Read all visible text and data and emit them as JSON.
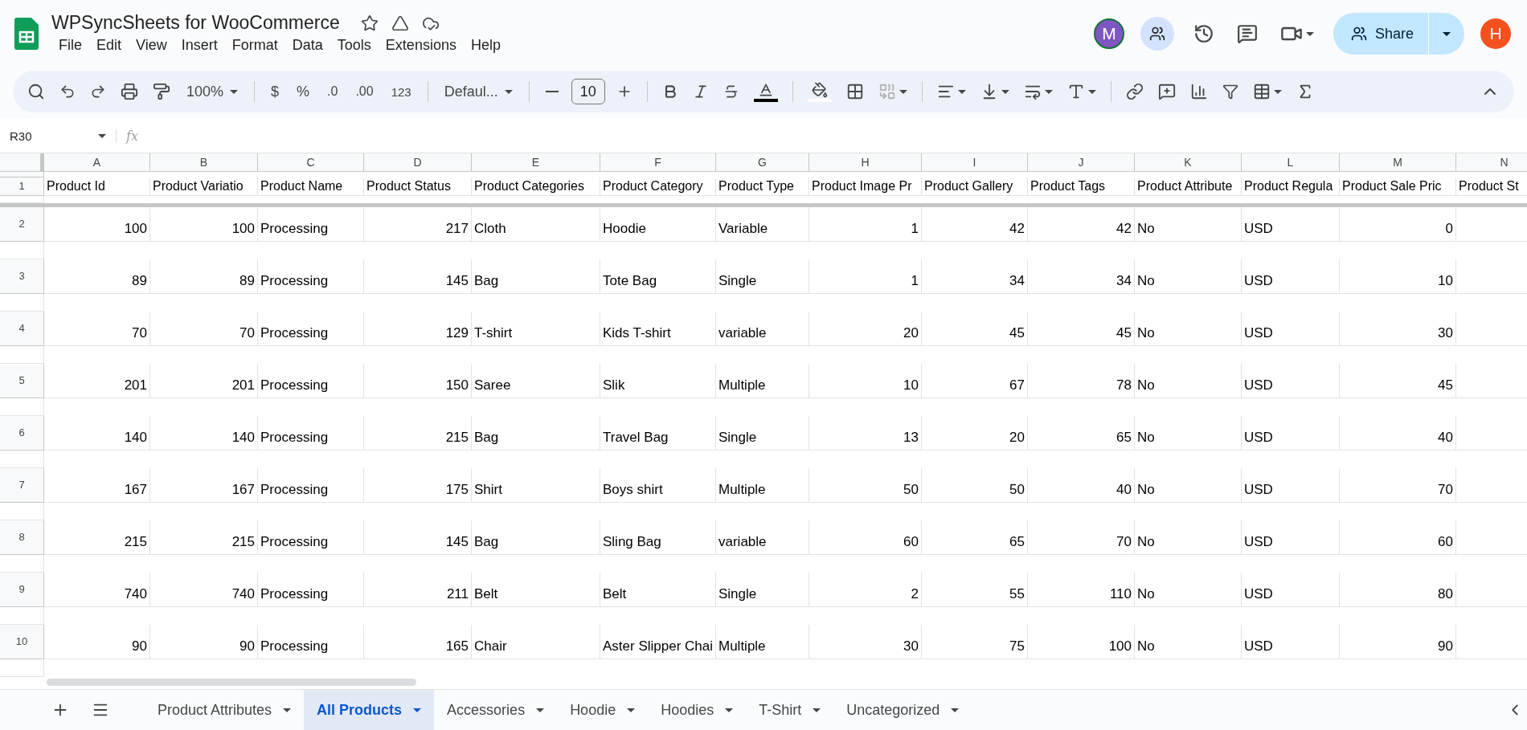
{
  "app": {
    "title": "WPSyncSheets for WooCommerce",
    "menu": [
      "File",
      "Edit",
      "View",
      "Insert",
      "Format",
      "Data",
      "Tools",
      "Extensions",
      "Help"
    ]
  },
  "header_actions": {
    "collaborator_initial": "M",
    "share_label": "Share",
    "account_initial": "H"
  },
  "toolbar": {
    "zoom": "100%",
    "currency": "$",
    "percent": "%",
    "decrease_decimals": ".0",
    "increase_decimals": ".00",
    "number_format": "123",
    "font": "Defaul...",
    "font_size": "10"
  },
  "formula_bar": {
    "cell_ref": "R30",
    "function_label": "fx"
  },
  "grid": {
    "columns": [
      "A",
      "B",
      "C",
      "D",
      "E",
      "F",
      "G",
      "H",
      "I",
      "J",
      "K",
      "L",
      "M",
      "N"
    ],
    "rows": [
      {
        "number": "1",
        "cells": [
          "Product Id",
          "Product Variatio",
          "Product Name",
          "Product Status",
          "Product Categories",
          "Product Category",
          "Product Type",
          "Product Image Pr",
          "Product Gallery",
          "Product Tags",
          "Product Attribute",
          "Product Regula",
          "Product Sale Pric",
          "Product St"
        ]
      },
      {
        "number": "2",
        "cells": [
          "100",
          "100",
          "Processing",
          "217",
          "Cloth",
          "Hoodie",
          "Variable",
          "1",
          "42",
          "42",
          "No",
          "USD",
          "0",
          ""
        ]
      },
      {
        "number": "3",
        "cells": [
          "89",
          "89",
          "Processing",
          "145",
          "Bag",
          "Tote Bag",
          "Single",
          "1",
          "34",
          "34",
          "No",
          "USD",
          "10",
          ""
        ]
      },
      {
        "number": "4",
        "cells": [
          "70",
          "70",
          "Processing",
          "129",
          "T-shirt",
          "Kids T-shirt",
          "variable",
          "20",
          "45",
          "45",
          "No",
          "USD",
          "30",
          ""
        ]
      },
      {
        "number": "5",
        "cells": [
          "201",
          "201",
          "Processing",
          "150",
          "Saree",
          "Slik",
          "Multiple",
          "10",
          "67",
          "78",
          "No",
          "USD",
          "45",
          ""
        ]
      },
      {
        "number": "6",
        "cells": [
          "140",
          "140",
          "Processing",
          "215",
          "Bag",
          "Travel Bag",
          "Single",
          "13",
          "20",
          "65",
          "No",
          "USD",
          "40",
          ""
        ]
      },
      {
        "number": "7",
        "cells": [
          "167",
          "167",
          "Processing",
          "175",
          "Shirt",
          "Boys shirt",
          "Multiple",
          "50",
          "50",
          "40",
          "No",
          "USD",
          "70",
          ""
        ]
      },
      {
        "number": "8",
        "cells": [
          "215",
          "215",
          "Processing",
          "145",
          "Bag",
          "Sling Bag",
          "variable",
          "60",
          "65",
          "70",
          "No",
          "USD",
          "60",
          ""
        ]
      },
      {
        "number": "9",
        "cells": [
          "740",
          "740",
          "Processing",
          "211",
          "Belt",
          "Belt",
          "Single",
          "2",
          "55",
          "110",
          "No",
          "USD",
          "80",
          ""
        ]
      },
      {
        "number": "10",
        "cells": [
          "90",
          "90",
          "Processing",
          "165",
          "Chair",
          "Aster Slipper Chai",
          "Multiple",
          "30",
          "75",
          "100",
          "No",
          "USD",
          "90",
          ""
        ]
      }
    ]
  },
  "sheet_tabs": [
    {
      "label": "Product Attributes",
      "selected": false
    },
    {
      "label": "All Products",
      "selected": true
    },
    {
      "label": "Accessories",
      "selected": false
    },
    {
      "label": "Hoodie",
      "selected": false
    },
    {
      "label": "Hoodies",
      "selected": false
    },
    {
      "label": "T-Shirt",
      "selected": false
    },
    {
      "label": "Uncategorized",
      "selected": false
    }
  ]
}
